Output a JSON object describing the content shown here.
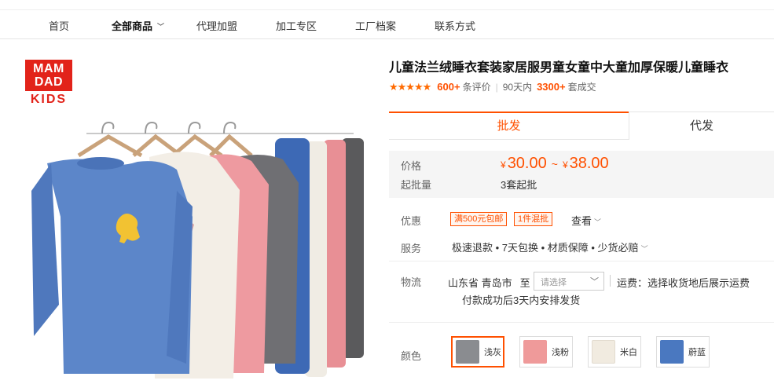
{
  "nav": {
    "items": [
      {
        "label": "首页"
      },
      {
        "label": "全部商品"
      },
      {
        "label": "代理加盟"
      },
      {
        "label": "加工专区"
      },
      {
        "label": "工厂档案"
      },
      {
        "label": "联系方式"
      }
    ]
  },
  "logo": {
    "line1": "MAM",
    "line2": "DAD",
    "line3": "KIDS"
  },
  "product": {
    "title": "儿童法兰绒睡衣套装家居服男童女童中大童加厚保暖儿童睡衣",
    "stars": "★★★★★",
    "review_count": "600+",
    "review_suffix": "条评价",
    "period": "90天内",
    "deal_count": "3300+",
    "deal_suffix": "套成交"
  },
  "tabs": {
    "wholesale": "批发",
    "dropship": "代发"
  },
  "price": {
    "label": "价格",
    "currency": "¥",
    "low": "30.00",
    "tilde": "~",
    "high": "38.00",
    "moq_label": "起批量",
    "moq_value": "3套起批"
  },
  "promo": {
    "label": "优惠",
    "tag1": "满500元包邮",
    "tag2": "1件混批",
    "view": "查看"
  },
  "service": {
    "label": "服务",
    "text": "极速退款 • 7天包换 • 材质保障 • 少货必赔"
  },
  "logistics": {
    "label": "物流",
    "origin": "山东省 青岛市",
    "to": "至",
    "select_placeholder": "请选择",
    "shipping": "运费：选择收货地后展示运费",
    "dispatch": "付款成功后3天内安排发货"
  },
  "color": {
    "label": "颜色",
    "options": [
      {
        "name": "浅灰",
        "color": "#8a8c90"
      },
      {
        "name": "浅粉",
        "color": "#ef9a9a"
      },
      {
        "name": "米白",
        "color": "#f1ebe0"
      },
      {
        "name": "蔚蓝",
        "color": "#4a78c0"
      }
    ]
  },
  "colors": {
    "accent": "#ff5000",
    "brand_red": "#e2231a"
  }
}
